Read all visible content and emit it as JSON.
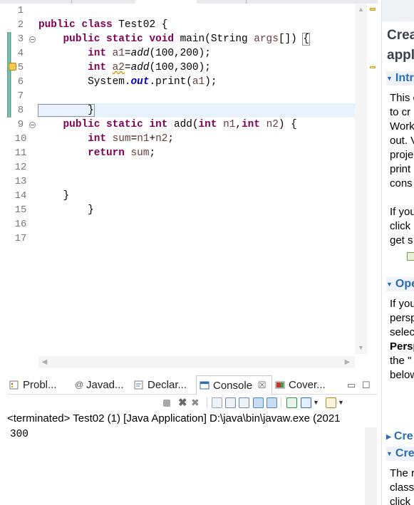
{
  "editor": {
    "line_numbers": [
      "1",
      "2",
      "3",
      "4",
      "5",
      "6",
      "7",
      "8",
      "9",
      "10",
      "11",
      "12",
      "13",
      "14",
      "15",
      "16",
      "17"
    ],
    "lines": [
      [],
      [
        {
          "t": "public class ",
          "c": "kw"
        },
        {
          "t": "Test02 {",
          "c": ""
        }
      ],
      [
        {
          "t": "    ",
          "c": ""
        },
        {
          "t": "public static void ",
          "c": "kw"
        },
        {
          "t": "main(String ",
          "c": ""
        },
        {
          "t": "args",
          "c": "var"
        },
        {
          "t": "[]) ",
          "c": ""
        },
        {
          "t": "{",
          "c": "brace-box"
        }
      ],
      [
        {
          "t": "        ",
          "c": ""
        },
        {
          "t": "int ",
          "c": "kw"
        },
        {
          "t": "a1",
          "c": "var"
        },
        {
          "t": "=",
          "c": ""
        },
        {
          "t": "add",
          "c": "mth"
        },
        {
          "t": "(100,200);",
          "c": ""
        }
      ],
      [
        {
          "t": "        ",
          "c": ""
        },
        {
          "t": "int ",
          "c": "kw"
        },
        {
          "t": "a2",
          "c": "var wavy"
        },
        {
          "t": "=",
          "c": ""
        },
        {
          "t": "add",
          "c": "mth"
        },
        {
          "t": "(100,300);",
          "c": ""
        }
      ],
      [
        {
          "t": "        System.",
          "c": ""
        },
        {
          "t": "out",
          "c": "fld"
        },
        {
          "t": ".print(",
          "c": ""
        },
        {
          "t": "a1",
          "c": "var"
        },
        {
          "t": ");",
          "c": ""
        }
      ],
      [],
      [
        {
          "t": "        }",
          "c": "brace-box"
        },
        {
          "t": "",
          "c": "caret"
        }
      ],
      [
        {
          "t": "    ",
          "c": ""
        },
        {
          "t": "public static int ",
          "c": "kw"
        },
        {
          "t": "add(",
          "c": ""
        },
        {
          "t": "int ",
          "c": "kw"
        },
        {
          "t": "n1",
          "c": "var"
        },
        {
          "t": ",",
          "c": ""
        },
        {
          "t": "int ",
          "c": "kw"
        },
        {
          "t": "n2",
          "c": "var"
        },
        {
          "t": ") {",
          "c": ""
        }
      ],
      [
        {
          "t": "        ",
          "c": ""
        },
        {
          "t": "int ",
          "c": "kw"
        },
        {
          "t": "sum",
          "c": "var"
        },
        {
          "t": "=",
          "c": ""
        },
        {
          "t": "n1",
          "c": "var"
        },
        {
          "t": "+",
          "c": ""
        },
        {
          "t": "n2",
          "c": "var"
        },
        {
          "t": ";",
          "c": ""
        }
      ],
      [
        {
          "t": "        ",
          "c": ""
        },
        {
          "t": "return ",
          "c": "kw"
        },
        {
          "t": "sum",
          "c": "var"
        },
        {
          "t": ";",
          "c": ""
        }
      ],
      [],
      [],
      [
        {
          "t": "    }",
          "c": ""
        }
      ],
      [
        {
          "t": "        }",
          "c": ""
        }
      ],
      [],
      []
    ],
    "current_line": 8
  },
  "panel": {
    "tabs": [
      {
        "label": "Probl...",
        "icon": "problems-icon"
      },
      {
        "label": "Javad...",
        "icon": "javadoc-icon"
      },
      {
        "label": "Declar...",
        "icon": "declaration-icon"
      },
      {
        "label": "Console",
        "icon": "console-icon",
        "close": "☒"
      },
      {
        "label": "Cover...",
        "icon": "coverage-icon"
      }
    ],
    "minimize_glyph": "▭",
    "maximize_glyph": "☐",
    "status": "<terminated> Test02 (1) [Java Application] D:\\java\\bin\\javaw.exe  (2021",
    "output": "300"
  },
  "help": {
    "title_line1": "Crea",
    "title_line2": "appl",
    "sections": [
      {
        "label": "Intr",
        "expanded": true
      },
      {
        "label": "Ope",
        "expanded": true
      },
      {
        "label": "Cre",
        "expanded": false
      },
      {
        "label": "Cre",
        "expanded": true
      }
    ],
    "intro_text": [
      "This c",
      "to cr",
      "Work",
      "out. V",
      "proje",
      "print",
      "cons"
    ],
    "intro_text2": [
      "If you",
      "click",
      "get s"
    ],
    "open_text": [
      "If you",
      "persp",
      "selec",
      "Persp",
      "the \"",
      "below"
    ],
    "create_text": [
      "The r",
      "class",
      "click"
    ]
  },
  "colors": {
    "keyword": "#7f0055",
    "variable": "#6a3e3e",
    "field": "#0000c0",
    "link": "#2a6db0",
    "current_line": "#e8f2fe"
  }
}
